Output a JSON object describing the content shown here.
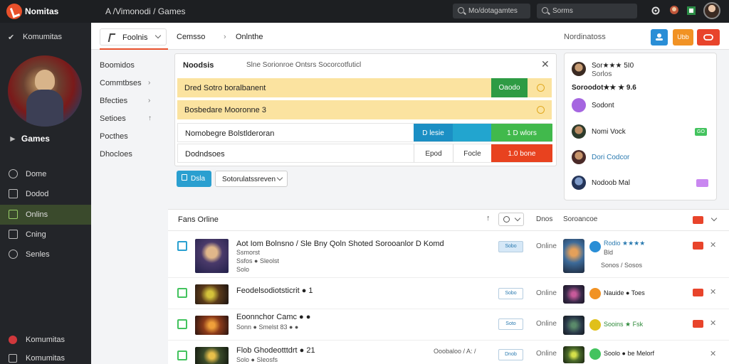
{
  "topbar": {
    "brand": "Nomitas",
    "crumb": "A  /Vimonodi / Games",
    "search1": "Mo/dotagamtes",
    "search2": "Sorms"
  },
  "sidebar": {
    "header": "Komumitas",
    "game_name": "Games",
    "items": [
      {
        "label": "Dome"
      },
      {
        "label": "Dodod"
      },
      {
        "label": "Onlins"
      },
      {
        "label": "Cning"
      },
      {
        "label": "Senles"
      }
    ],
    "footer": [
      {
        "label": "Komumitas"
      },
      {
        "label": "Komumitas"
      }
    ]
  },
  "subnav": {
    "button": "Foolnis",
    "title1": "Cemsso",
    "title2": "Onlnthe",
    "right": "Nordinatoss",
    "btn_orange": "Ubb"
  },
  "leftnav": {
    "items": [
      {
        "label": "Boomidos"
      },
      {
        "label": "Commtbses"
      },
      {
        "label": "Bfecties"
      },
      {
        "label": "Setioes"
      },
      {
        "label": "Pocthes"
      },
      {
        "label": "Dhocloes"
      }
    ]
  },
  "panel": {
    "title": "Noodsis",
    "subtitle": "Slne  Sorionroe Ontsrs  Socorcotfuticl",
    "rows": [
      {
        "label": "Dred Sotro boralbanent",
        "cell": "Oaodo"
      },
      {
        "label": "Bosbedare Mooronne 3"
      },
      {
        "label": "Nomobegre Bolstlderoran",
        "cell1": "D lesie",
        "cell2": "",
        "cell3": "1 D wlors"
      },
      {
        "label": "Dodndsoes",
        "cell1": "Epod",
        "cell2": "Focle",
        "cell3": "1.0 bone"
      }
    ],
    "button": "Dsla",
    "select": "Sotorulatssreven"
  },
  "friends": {
    "items": [
      {
        "name": "Sor★★★ 5I0",
        "sub": "Sorlos"
      },
      {
        "name": "Soroodot★★ ★ 9.6"
      },
      {
        "name": "Sodont"
      },
      {
        "name": "Nomi Vock",
        "tag": "GO"
      },
      {
        "name": "Dori Codcor"
      },
      {
        "name": "Nodoob Mal"
      }
    ],
    "colors": {
      "tag_green": "#43c35e",
      "tag_purple": "#c987f0",
      "purple_avatar": "#a566e0"
    }
  },
  "list": {
    "title": "Fans Orline",
    "head_status": "Dnos",
    "head_friends": "Soroancoe",
    "games": [
      {
        "title": "Aot Iom Bolnsno / Sle Bny Qoln Shoted Sorooanlor  D Komd",
        "meta1": "Ssmorst",
        "meta2": "Ssfos  ● Sleolst",
        "meta3": "Solo",
        "btn": "Sobo",
        "status": "Online",
        "friend": "Rodio ★★★★",
        "friend2": "Bld",
        "friend3": "Sonos / Sosos"
      },
      {
        "title": "Feodelsodiotsticrit  ● 1",
        "btn": "Sobo",
        "status": "Online",
        "friend": "Nauide ● Toes"
      },
      {
        "title": "Eoonnchor Camc  ● ●",
        "meta1": "Sonn  ● Smelst 83  ● ●",
        "btn": "Soto",
        "status": "Online",
        "friend": "Sooins  ★  Fsk"
      },
      {
        "title": "Flob Ghodeotttdrt  ● 21",
        "meta1": "Solo  ● Sleosfs",
        "mid": "Ooobaloo / A: /",
        "btn": "Dnob",
        "status": "Online",
        "friend": "Soolo ● be Melorf"
      }
    ]
  },
  "colors": {
    "accent": "#e8502b",
    "blue": "#2a9fd0",
    "green": "#43c35e",
    "red": "#e8442b",
    "yellow_row": "#fbe3a0"
  }
}
